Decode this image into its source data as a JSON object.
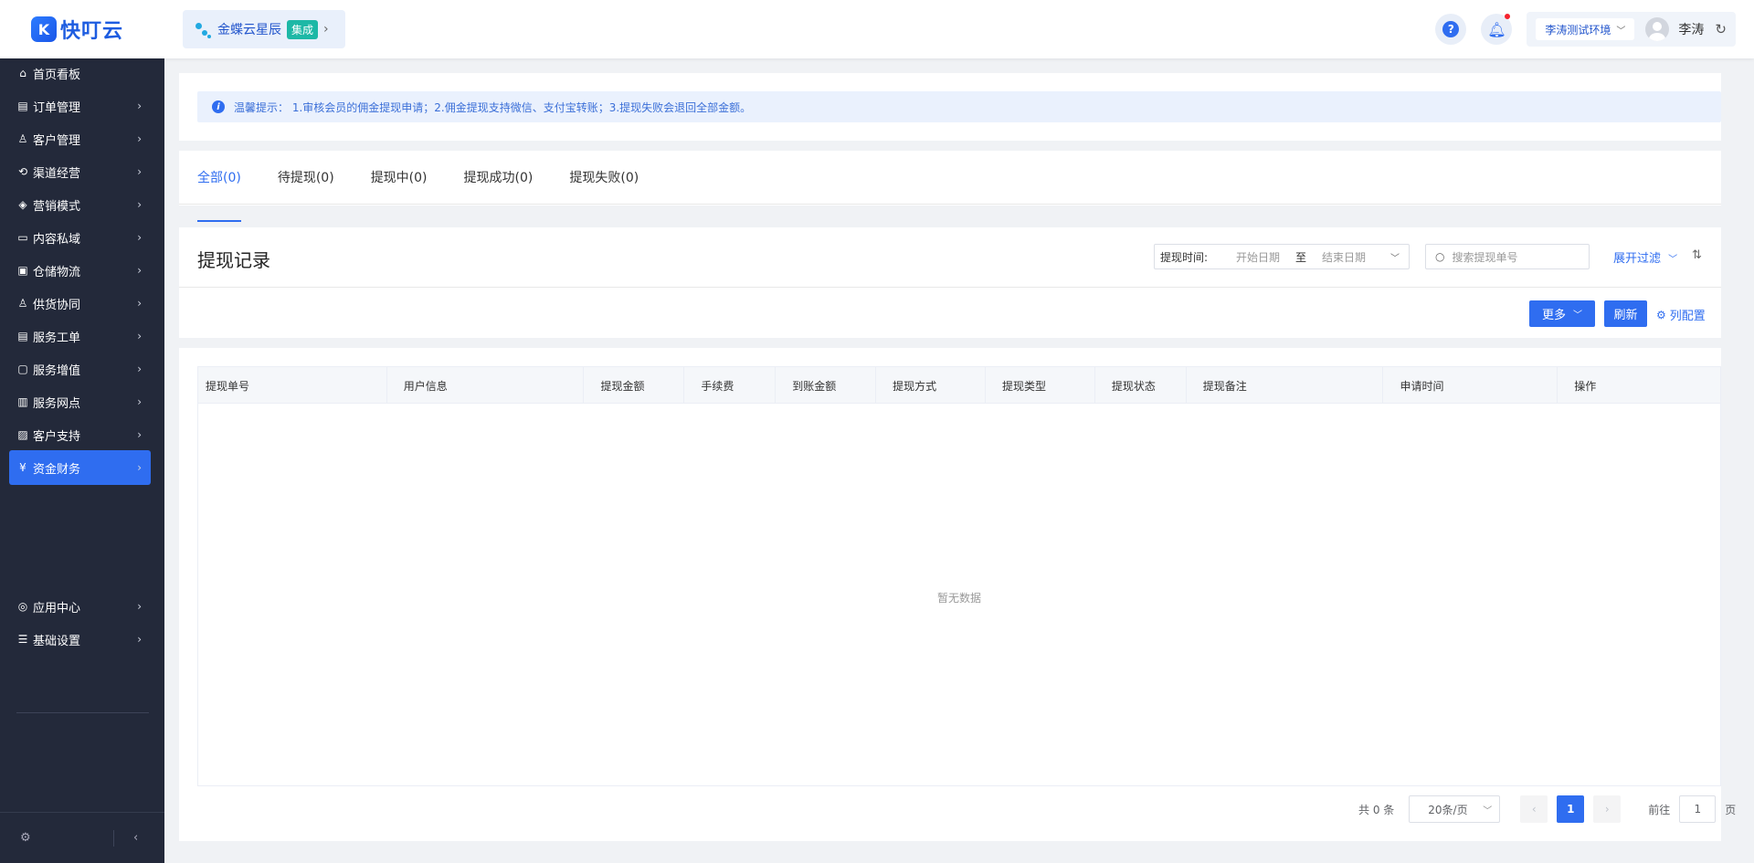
{
  "brand": {
    "name": "快叮云",
    "mark": "K"
  },
  "product": {
    "name": "金蝶云星辰",
    "tag": "集成"
  },
  "header": {
    "environment": "李涛测试环境",
    "user_name": "李涛"
  },
  "sidebar": {
    "items": [
      {
        "label": "首页看板",
        "icon": "home-icon",
        "glyph": "⌂",
        "has_arrow": false
      },
      {
        "label": "订单管理",
        "icon": "order-icon",
        "glyph": "▤",
        "has_arrow": true
      },
      {
        "label": "客户管理",
        "icon": "user-icon",
        "glyph": "♙",
        "has_arrow": true
      },
      {
        "label": "渠道经营",
        "icon": "channel-icon",
        "glyph": "⟲",
        "has_arrow": true
      },
      {
        "label": "营销模式",
        "icon": "tag-icon",
        "glyph": "◈",
        "has_arrow": true
      },
      {
        "label": "内容私域",
        "icon": "image-icon",
        "glyph": "▭",
        "has_arrow": true
      },
      {
        "label": "仓储物流",
        "icon": "warehouse-icon",
        "glyph": "▣",
        "has_arrow": true
      },
      {
        "label": "供货协同",
        "icon": "supply-icon",
        "glyph": "♙",
        "has_arrow": true
      },
      {
        "label": "服务工单",
        "icon": "ticket-icon",
        "glyph": "▤",
        "has_arrow": true
      },
      {
        "label": "服务增值",
        "icon": "bag-icon",
        "glyph": "▢",
        "has_arrow": true
      },
      {
        "label": "服务网点",
        "icon": "store-icon",
        "glyph": "▥",
        "has_arrow": true
      },
      {
        "label": "客户支持",
        "icon": "support-icon",
        "glyph": "▨",
        "has_arrow": true
      },
      {
        "label": "资金财务",
        "icon": "finance-icon",
        "glyph": "¥",
        "has_arrow": true,
        "active": true
      }
    ],
    "bottom_items": [
      {
        "label": "应用中心",
        "icon": "app-center-icon",
        "glyph": "◎"
      },
      {
        "label": "基础设置",
        "icon": "settings-icon",
        "glyph": "☰"
      }
    ]
  },
  "notice": {
    "text": "温馨提示： 1.审核会员的佣金提现申请；2.佣金提现支持微信、支付宝转账；3.提现失败会退回全部金额。"
  },
  "tabs": [
    {
      "label": "全部(0)",
      "active": true
    },
    {
      "label": "待提现(0)"
    },
    {
      "label": "提现中(0)"
    },
    {
      "label": "提现成功(0)"
    },
    {
      "label": "提现失败(0)"
    }
  ],
  "records": {
    "title": "提现记录",
    "date_label": "提现时间:",
    "start_placeholder": "开始日期",
    "to": "至",
    "end_placeholder": "结束日期",
    "search_placeholder": "搜索提现单号",
    "expand_filter": "展开过滤"
  },
  "toolbar": {
    "more": "更多",
    "refresh": "刷新",
    "column_config": "列配置"
  },
  "table": {
    "columns": [
      "提现单号",
      "用户信息",
      "提现金额",
      "手续费",
      "到账金额",
      "提现方式",
      "提现类型",
      "提现状态",
      "提现备注",
      "申请时间",
      "操作"
    ],
    "empty_text": "暂无数据"
  },
  "pagination": {
    "total": "共 0 条",
    "page_size": "20条/页",
    "current_page": "1",
    "goto_label": "前往",
    "goto_value": "1",
    "page_unit": "页"
  },
  "colors": {
    "primary": "#2f6df0",
    "sidebar_bg": "#23293a",
    "notice_bg": "#eaf1fd"
  }
}
